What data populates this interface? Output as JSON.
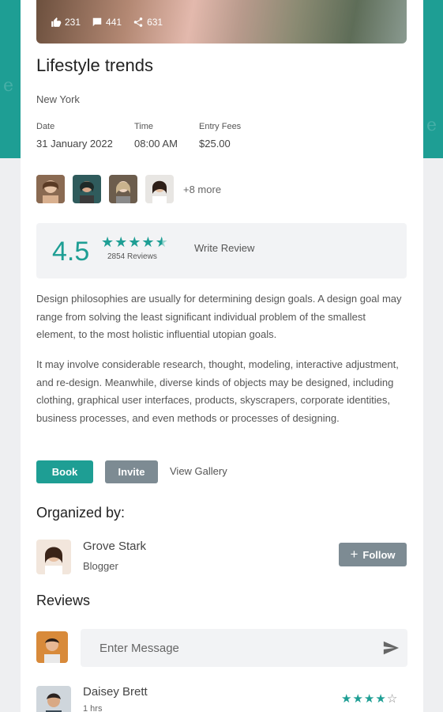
{
  "colors": {
    "accent": "#1e9e94",
    "secondary_button": "#7d8b93"
  },
  "hero": {
    "stats": [
      {
        "icon": "thumbs-up-icon",
        "value": "231"
      },
      {
        "icon": "comment-icon",
        "value": "441"
      },
      {
        "icon": "share-icon",
        "value": "631"
      }
    ]
  },
  "event": {
    "title": "Lifestyle trends",
    "location": "New York",
    "date_label": "Date",
    "date_value": "31 January 2022",
    "time_label": "Time",
    "time_value": "08:00 AM",
    "fee_label": "Entry Fees",
    "fee_value": "$25.00"
  },
  "attendees": {
    "more_label": "+8 more"
  },
  "rating": {
    "score": "4.5",
    "stars": 4.5,
    "reviews_count": "2854 Reviews",
    "write_review_label": "Write Review"
  },
  "description": {
    "para1": "Design philosophies are usually for determining design goals. A design goal may range from solving the least significant individual problem of the smallest element, to the most holistic influential utopian goals.",
    "para2": "It may involve considerable research, thought, modeling, interactive adjustment, and re-design. Meanwhile, diverse kinds of objects may be designed, including clothing, graphical user interfaces, products, skyscrapers, corporate identities, business processes, and even methods or processes of designing."
  },
  "actions": {
    "book_label": "Book",
    "invite_label": "Invite",
    "gallery_label": "View Gallery"
  },
  "organizer": {
    "section_title": "Organized by:",
    "name": "Grove Stark",
    "role": "Blogger",
    "follow_label": "Follow"
  },
  "reviews": {
    "section_title": "Reviews",
    "input_placeholder": "Enter Message",
    "items": [
      {
        "name": "Daisey Brett",
        "time": "1 hrs",
        "stars": 4
      }
    ]
  }
}
